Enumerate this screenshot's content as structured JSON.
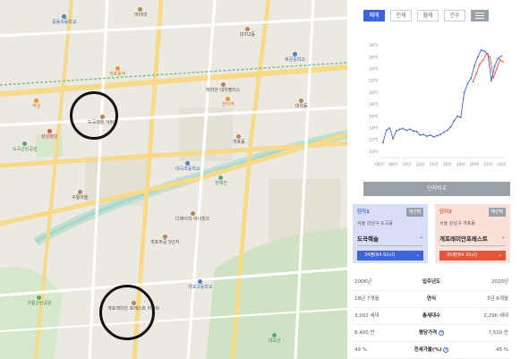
{
  "map": {
    "pois": [
      {
        "label": "중동초등학교",
        "type": "school"
      },
      {
        "label": "마터대",
        "type": "default"
      },
      {
        "label": "대치2동",
        "type": "default"
      },
      {
        "label": "휘문중학교",
        "type": "school"
      },
      {
        "label": "래미안 대치팰리스",
        "type": "default"
      },
      {
        "label": "대치동",
        "type": "default"
      },
      {
        "label": "역삼",
        "type": "default"
      },
      {
        "label": "도곡렉슬 아파트",
        "type": "default"
      },
      {
        "label": "도곡근린공원",
        "type": "park"
      },
      {
        "label": "삼성병원",
        "type": "red"
      },
      {
        "label": "대곡초등학교",
        "type": "school"
      },
      {
        "label": "개포동",
        "type": "default"
      },
      {
        "label": "구룡마을",
        "type": "default"
      },
      {
        "label": "양재천",
        "type": "park"
      },
      {
        "label": "개포주공 5단지",
        "type": "default"
      },
      {
        "label": "개포래미안 포레스트 아파트",
        "type": "default"
      },
      {
        "label": "구룡근린공원",
        "type": "park"
      },
      {
        "label": "대모산",
        "type": "park"
      },
      {
        "label": "개포고등학교",
        "type": "school"
      },
      {
        "label": "한티역",
        "type": "orange"
      },
      {
        "label": "디에이치 아너힐즈",
        "type": "default"
      },
      {
        "label": "개포동역",
        "type": "orange"
      }
    ]
  },
  "tabs": [
    {
      "label": "매매",
      "active": true
    },
    {
      "label": "전세",
      "active": false
    },
    {
      "label": "월세",
      "active": false
    },
    {
      "label": "건수",
      "active": false
    }
  ],
  "tab_icon": "list-bars-icon",
  "chart_data": {
    "type": "line",
    "title": "",
    "x_tick_labels": [
      "06년",
      "08년",
      "10년",
      "12년",
      "14년",
      "16년",
      "18년",
      "20년",
      "22년",
      "24년"
    ],
    "y_tick_labels": [
      "10억",
      "12억",
      "14억",
      "16억",
      "18억",
      "20억",
      "22억",
      "24억",
      "26억",
      "28억"
    ],
    "ylim": [
      9,
      29
    ],
    "xlim": [
      2006,
      2024.5
    ],
    "grid": false,
    "series": [
      {
        "color": "#3f63d8",
        "x": [
          2006.5,
          2007,
          2007.5,
          2008,
          2008.5,
          2009,
          2009.5,
          2010,
          2010.5,
          2011,
          2011.5,
          2012,
          2012.5,
          2013,
          2013.5,
          2014,
          2014.5,
          2015,
          2015.5,
          2016,
          2016.5,
          2017,
          2017.5,
          2018,
          2018.5,
          2019,
          2019.5,
          2020,
          2020.5,
          2021,
          2021.5,
          2022,
          2022.5,
          2023,
          2023.5,
          2024
        ],
        "values": [
          11.5,
          13.6,
          14.0,
          12.2,
          13.5,
          13.8,
          13.9,
          13.6,
          13.8,
          13.5,
          13.4,
          12.8,
          12.9,
          12.6,
          12.8,
          12.5,
          12.7,
          12.9,
          13.3,
          13.6,
          14.2,
          15.2,
          16.0,
          15.8,
          20.0,
          21.5,
          22.4,
          24.5,
          26.0,
          27.2,
          27.0,
          26.5,
          22.0,
          24.5,
          25.8,
          26.2
        ]
      },
      {
        "color": "#e5553a",
        "x": [
          2019.8,
          2020.3,
          2020.8,
          2021.3,
          2021.8,
          2022.3,
          2022.8,
          2023.3,
          2023.8,
          2024.2
        ],
        "values": [
          21.8,
          23.2,
          24.8,
          25.5,
          26.6,
          26.0,
          22.5,
          24.0,
          25.6,
          25.2
        ]
      }
    ]
  },
  "compare_button": "단지비교",
  "complex1": {
    "title": "단지1",
    "reset": "재선택",
    "address": "서울 강남구 도곡동",
    "name": "도곡렉슬",
    "size": "34평(84.92㎡)",
    "color": "#3f63d8"
  },
  "complex2": {
    "title": "단지2",
    "reset": "재선택",
    "address": "서울 강남구 개포동",
    "name": "개포래미안포레스트",
    "size": "35평(84.33㎡)",
    "color": "#e5553a"
  },
  "stats": [
    {
      "left": "2006년",
      "label": "입주년도",
      "right": "2020년",
      "help": false
    },
    {
      "left": "18년 7개월",
      "label": "연식",
      "right": "3년 6개월",
      "help": false
    },
    {
      "left": "3,002 세대",
      "label": "총세대수",
      "right": "2,296 세대",
      "help": false
    },
    {
      "left": "8,400 만",
      "label": "평당가격",
      "right": "7,510 만",
      "help": true
    },
    {
      "left": "49 %",
      "label": "전세가율(%)",
      "right": "45 %",
      "help": true
    }
  ]
}
